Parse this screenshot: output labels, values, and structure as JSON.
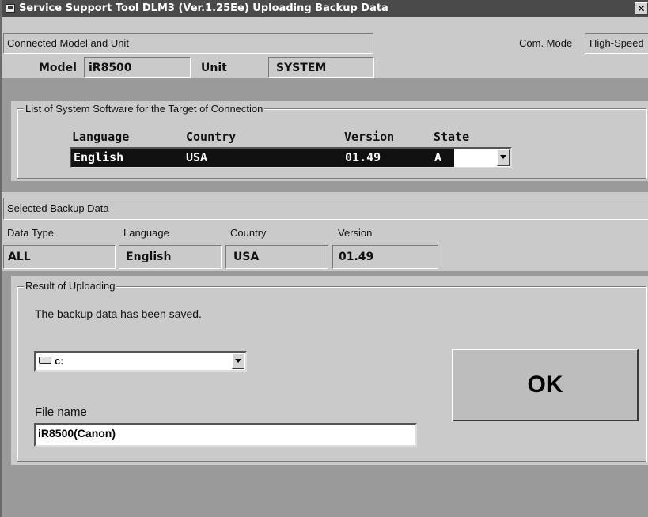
{
  "window": {
    "title": "Service Support Tool DLM3 (Ver.1.25Ee) Uploading Backup Data",
    "close_glyph": "✕"
  },
  "connected": {
    "section_label": "Connected Model and Unit",
    "com_mode_label": "Com. Mode",
    "com_mode_value": "High-Speed",
    "model_label": "Model",
    "model_value": "iR8500",
    "unit_label": "Unit",
    "unit_value": "SYSTEM"
  },
  "software_list": {
    "legend": "List of System Software for the Target of Connection",
    "headers": {
      "language": "Language",
      "country": "Country",
      "version": "Version",
      "state": "State"
    },
    "selected": {
      "language": "English",
      "country": "USA",
      "version": "01.49",
      "state": "A"
    }
  },
  "backup": {
    "section_label": "Selected Backup Data",
    "headers": {
      "data_type": "Data Type",
      "language": "Language",
      "country": "Country",
      "version": "Version"
    },
    "values": {
      "data_type": "ALL",
      "language": "English",
      "country": "USA",
      "version": "01.49"
    }
  },
  "result": {
    "legend": "Result of Uploading",
    "message": "The backup data has been saved.",
    "drive_value": "c:",
    "drive_icon": "drive-icon",
    "file_name_label": "File name",
    "file_name_value": "iR8500(Canon)",
    "ok_label": "OK"
  },
  "colors": {
    "title_bar": "#4a4a4a",
    "selection": "#111111",
    "panel": "#cacaca",
    "background": "#9a9a9a"
  }
}
